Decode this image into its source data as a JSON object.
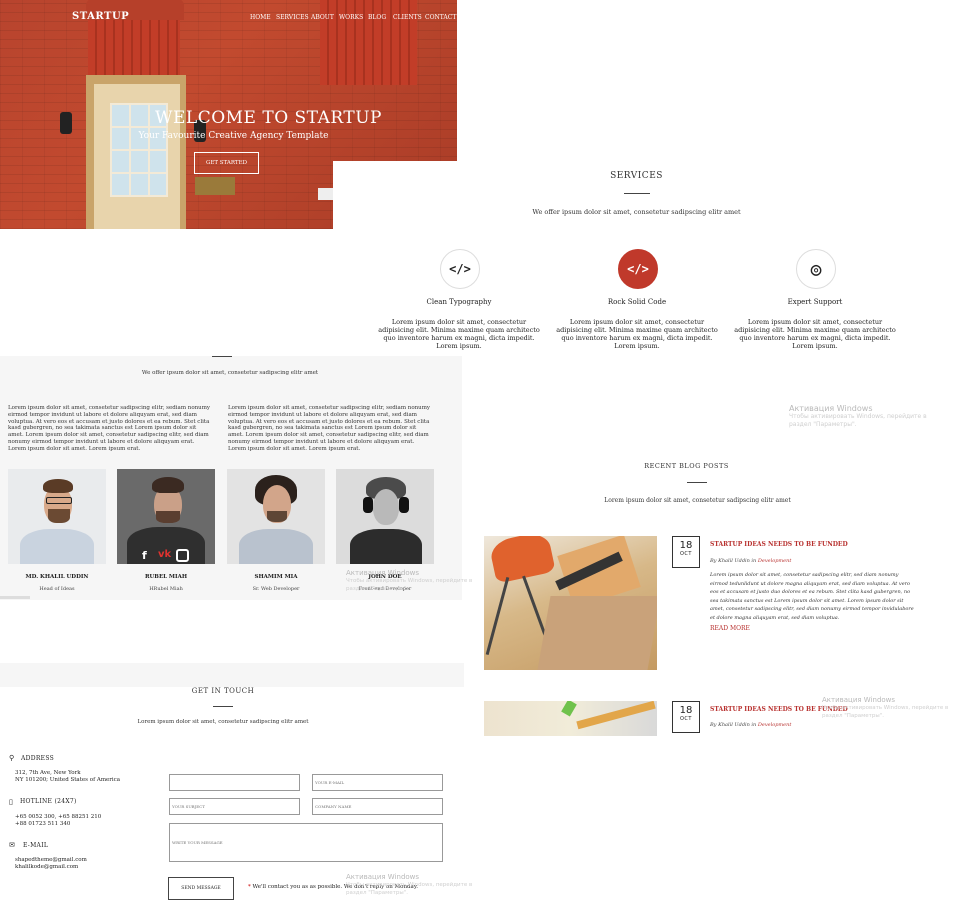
{
  "hero": {
    "brand": "STARTUP",
    "nav": [
      "HOME",
      "SERVICES",
      "ABOUT",
      "WORKS",
      "BLOG",
      "CLIENTS",
      "CONTACT"
    ],
    "title": "WELCOME TO STARTUP",
    "subtitle": "Your Favourite Creative Agency Template",
    "cta": "GET STARTED"
  },
  "services": {
    "title": "SERVICES",
    "intro": "We offer ipsum dolor sit amet, consetetur sadipscing elitr amet",
    "items": [
      {
        "icon": "code-icon",
        "glyph": "</>",
        "title": "Clean Typography",
        "desc": "Lorem ipsum dolor sit amet, consectetur adipisicing elit. Minima maxime quam architecto quo inventore harum ex magni, dicta impedit. Lorem ipsum."
      },
      {
        "icon": "code-icon",
        "glyph": "</>",
        "title": "Rock Solid Code",
        "desc": "Lorem ipsum dolor sit amet, consectetur adipisicing elit. Minima maxime quam architecto quo inventore harum ex magni, dicta impedit. Lorem ipsum."
      },
      {
        "icon": "lifebuoy-icon",
        "glyph": "◎",
        "title": "Expert Support",
        "desc": "Lorem ipsum dolor sit amet, consectetur adipisicing elit. Minima maxime quam architecto quo inventore harum ex magni, dicta impedit. Lorem ipsum."
      }
    ]
  },
  "about": {
    "intro": "We offer ipsum dolor sit amet, consetetur sadipscing elitr amet",
    "col1": "Lorem ipsum dolor sit amet, consetetur sadipscing elitr, sediam nonumy eirmod tempor invidunt ut labore et dolore aliquyam erat, sed diam voluptua. At vero eos et accusam et justo dolores et ea rebum. Stet clita kasd gubergren, no sea takimata sanctus est Lorem ipsum dolor sit amet. Lorem ipsum dolor sit amet, consetetur sadipscing elitr, sed diam nonumy eirmod tempor invidunt ut labore et dolore aliquyam erat. Lorem ipsum dolor sit amet. Lorem ipsum erat.",
    "col2": "Lorem ipsum dolor sit amet, consetetur sadipscing elitr, sediam nonumy eirmod tempor invidunt ut labore et dolore aliquyam erat, sed diam voluptua. At vero eos et accusam et justo dolores et ea rebum. Stet clita kasd gubergren, no sea takimata sanctus est Lorem ipsum dolor sit amet. Lorem ipsum dolor sit amet, consetetur sadipscing elitr, sed diam nonumy eirmod tempor invidunt ut labore et dolore aliquyam erat. Lorem ipsum dolor sit amet. Lorem ipsum erat.",
    "members": [
      {
        "name": "MD. KHALIL UDDIN",
        "role": "Head of Ideas"
      },
      {
        "name": "RUBEL MIAH",
        "role": "HRubel Miah"
      },
      {
        "name": "SHAMIM MIA",
        "role": "Sr. Web Developer"
      },
      {
        "name": "JOHN DOE",
        "role": "Front-end Developer"
      }
    ],
    "social": [
      "facebook-icon",
      "vk-icon",
      "instagram-icon"
    ]
  },
  "blog": {
    "title": "RECENT BLOG POSTS",
    "intro": "Lorem ipsum dolor sit amet, consetetur sadipscing elitr amet",
    "posts": [
      {
        "day": "18",
        "month": "OCT",
        "title": "STARTUP IDEAS NEEDS TO BE FUNDED",
        "by": "By Khalil Uddin in",
        "category": "Development",
        "body": "Lorem ipsum dolor sit amet, consetetur sadipscing elitr, sed diam nonumy eirmod tedunlidunt ut dolore magna aliquyam erat, sed diam voluptua. At vero eos et accusam et justo duo dolores et ea rebum. Stet clita kasd gubergren, no sea takimata sanctus est Lorem ipsum dolor sit amet. Lorem ipsum dolor sit amet, consetetur sadipscing elitr, sed diam nonumy eirmod tempor invidulabore et dolore magna aliquyam erat, sed diam voluptua.",
        "read_more": "READ MORE"
      },
      {
        "day": "18",
        "month": "OCT",
        "title": "STARTUP IDEAS NEEDS TO BE FUNDED",
        "by": "By Khalil Uddin in",
        "category": "Development"
      }
    ]
  },
  "contact": {
    "title": "GET IN TOUCH",
    "intro": "Lorem ipsum dolor sit amet, consetetur sadipscing elitr amet",
    "address_label": "ADDRESS",
    "address": [
      "312, 7th Ave, New York",
      "NY 101200; United States of America"
    ],
    "hotline_label": "HOTLINE (24X7)",
    "hotline": [
      "+65 0052 300, +65 88251 210",
      "+88 01723 511 340"
    ],
    "email_label": "E-MAIL",
    "emails": [
      "shapedtheme@gmail.com",
      "khalilkode@gmail.com"
    ],
    "fields": {
      "name": "",
      "email": "YOUR E-MAIL",
      "subject": "YOUR SUBJECT",
      "company": "COMPANY NAME",
      "message": "WRITE YOUR MESSAGE"
    },
    "send": "SEND MESSAGE",
    "note": "We'll contact you as as possible. We don't reply on Monday."
  },
  "watermark": {
    "title": "Активация Windows",
    "line1": "Чтобы активировать Windows, перейдите в",
    "line2": "раздел \"Параметры\".",
    "short_title": "Активация Windows",
    "short_line1": "Чтобы активировать Windows, перейдите в",
    "short_line2": "раздел \"Параметры\"."
  }
}
